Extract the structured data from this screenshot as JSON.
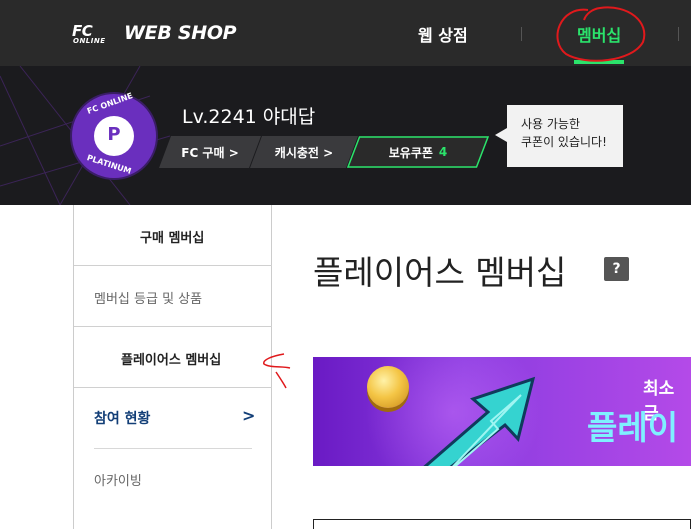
{
  "header": {
    "logo_fc": "FC",
    "logo_online": "ONLINE",
    "brand": "WEB SHOP",
    "nav": [
      {
        "label": "웹 상점",
        "active": false
      },
      {
        "label": "멤버십",
        "active": true
      }
    ],
    "active_color": "#2be36b"
  },
  "profile": {
    "badge_top": "FC ONLINE",
    "badge_letter": "P",
    "badge_bottom": "PLATINUM",
    "level_name": "Lv.2241 야대답",
    "buttons": {
      "fc_buy": "FC 구매 >",
      "cash": "캐시충전 >",
      "coupon_label": "보유쿠폰",
      "coupon_count": "4"
    },
    "tooltip_line1": "사용 가능한",
    "tooltip_line2": "쿠폰이 있습니다!"
  },
  "sidebar": {
    "items": [
      {
        "label": "구매 멤버십"
      },
      {
        "label": "멤버십 등급 및 상품"
      },
      {
        "label": "플레이어스 멤버십"
      },
      {
        "label": "참여 현황"
      },
      {
        "label": "아카이빙"
      }
    ],
    "chevron": ">"
  },
  "main": {
    "title": "플레이어스 멤버십",
    "help": "?",
    "banner_sub": "최소 금",
    "banner_title": "플레이"
  },
  "colors": {
    "nav_bg": "#2a2a2a",
    "profile_bg": "#1b1b1e",
    "badge": "#6a2fbe",
    "sidebar_link": "#123e77",
    "annotation": "#e0191c"
  }
}
